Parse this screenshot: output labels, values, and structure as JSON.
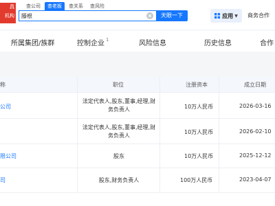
{
  "header": {
    "logo_top": "具",
    "logo_bottom": "机构",
    "search_tabs": [
      "查公司",
      "查老板",
      "查关系",
      "查风险"
    ],
    "active_search_tab": 1,
    "search_value": "滕根",
    "search_button": "天眼一下",
    "app_button": "应用",
    "business_link": "商务合作"
  },
  "nav": {
    "items": [
      {
        "label": "所属集团/族群",
        "count": ""
      },
      {
        "label": "控制企业",
        "count": "1"
      },
      {
        "label": "风险信息",
        "count": ""
      },
      {
        "label": "历史信息",
        "count": ""
      },
      {
        "label": "合作",
        "count": ""
      }
    ]
  },
  "table": {
    "headers": [
      "称",
      "职位",
      "注册资本",
      "成立日期"
    ],
    "rows": [
      {
        "company": "公司",
        "position": "法定代表人,股东,董事,经理,财务负责人",
        "capital": "10万人民币",
        "date": "2026-03-16"
      },
      {
        "company": "",
        "position": "法定代表人,股东,董事,经理,财务负责人",
        "capital": "10万人民币",
        "date": "2026-02-10"
      },
      {
        "company": "限公司",
        "position": "股东",
        "capital": "10万人民币",
        "date": "2025-12-12"
      },
      {
        "company": "司",
        "position": "股东,财务负责人",
        "capital": "100万人民币",
        "date": "2023-04-07"
      }
    ]
  },
  "colors": {
    "accent": "#1677ff",
    "logo_red": "#e23b2e",
    "header_bg": "#f4f7fc"
  }
}
